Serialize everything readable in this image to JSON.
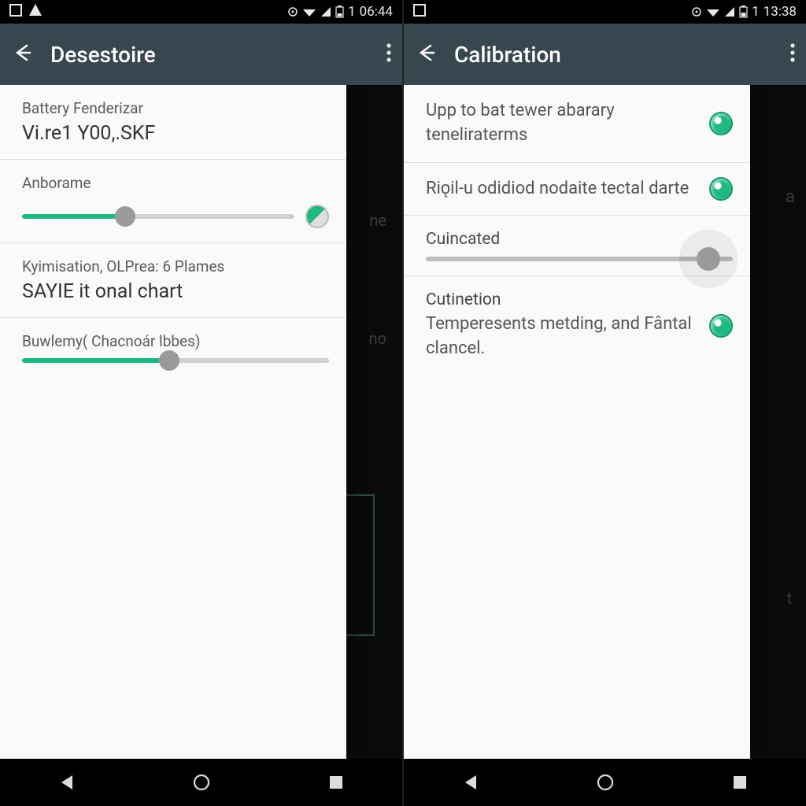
{
  "left": {
    "status": {
      "time": "06:44",
      "battery": "1"
    },
    "title": "Desestoire",
    "sections": {
      "s1": {
        "label": "Battery Fenderizar",
        "value": "Vi.re1 Y00,.SKF"
      },
      "s2": {
        "label": "Anborame",
        "slider_pct": 38
      },
      "s3": {
        "label": "Kyimisation, OLPrea: 6 Plames",
        "value": "SAYIE it onal chart"
      },
      "s4": {
        "label": "Buwlemy( Chacnoár lbbes)",
        "slider_pct": 48
      }
    },
    "bg": {
      "hint1": "ne",
      "hint2": "no",
      "box": "06"
    }
  },
  "right": {
    "status": {
      "time": "13:38",
      "battery": "1"
    },
    "title": "Calibration",
    "rows": {
      "r1": {
        "text": "Upp to bat tewer abarary teneliraterms",
        "on": true
      },
      "r2": {
        "text": "Riǫil-u odidiod nodaite tectal darte",
        "on": true
      },
      "r3": {
        "label": "Cuincated",
        "slider_pct": 92
      },
      "r4": {
        "title": "Cutinetion",
        "body": "Temperesents metding, and Fântal clancel.",
        "on": true
      }
    },
    "bg": {
      "hint1": "a",
      "hint2": "t"
    }
  },
  "accent": "#1DB980",
  "appbar_color": "#37474F"
}
